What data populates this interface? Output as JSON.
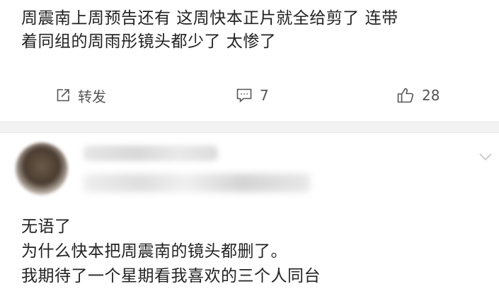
{
  "post": {
    "text_lines": [
      "周震南上周预告还有  这周快本正片就全给剪了  连带",
      "着同组的周雨彤镜头都少了  太惨了"
    ],
    "actions": {
      "repost_label": "转发",
      "comment_count": "7",
      "like_count": "28"
    }
  },
  "comment": {
    "text_lines": [
      "无语了",
      "为什么快本把周震南的镜头都删了。",
      "我期待了一个星期看我喜欢的三个人同台"
    ]
  },
  "colors": {
    "text": "#222222",
    "muted": "#555555",
    "divider": "#f2f2f2"
  },
  "icons": [
    "repost-icon",
    "comment-icon",
    "like-icon",
    "chevron-down-icon"
  ]
}
